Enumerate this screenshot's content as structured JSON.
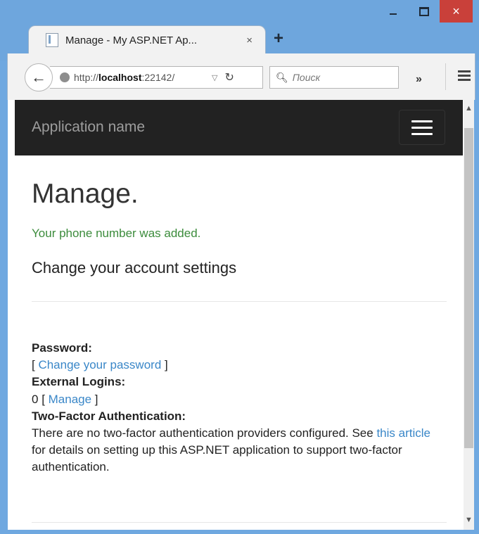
{
  "browser": {
    "tab_title": "Manage - My ASP.NET Ap...",
    "tab_close": "×",
    "new_tab": "+",
    "url_prefix": "http://",
    "url_host": "localhost",
    "url_rest": ":22142/",
    "search_placeholder": "Поиск",
    "overflow": "»",
    "window_buttons": {
      "close": "×"
    }
  },
  "navbar": {
    "brand": "Application name"
  },
  "page": {
    "title": "Manage.",
    "status_message": "Your phone number was added.",
    "subtitle": "Change your account settings",
    "password_label": "Password:",
    "password_open": "[ ",
    "password_link": "Change your password",
    "password_close": " ]",
    "external_label": "External Logins:",
    "external_count": "0",
    "external_open": " [ ",
    "external_link": "Manage",
    "external_close": " ]",
    "twofactor_label": "Two-Factor Authentication:",
    "twofactor_text_1": "There are no two-factor authentication providers configured. See ",
    "twofactor_link": "this article",
    "twofactor_text_2": " for details on setting up this ASP.NET application to support two-factor authentication."
  },
  "colors": {
    "navbar_bg": "#222222",
    "link": "#3a87c8",
    "success": "#3c8c3c",
    "close_button": "#c9403a"
  }
}
